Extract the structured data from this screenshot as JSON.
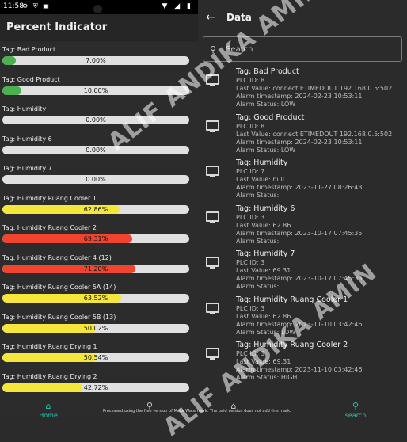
{
  "status": {
    "time": "11:58",
    "left_icons": "⚙ ⛨ ▣",
    "right_icons": "▼ ◢ ▮"
  },
  "left": {
    "title": "Percent Indicator",
    "items": [
      {
        "tag": "Tag: Bad Product",
        "percent_text": "7.00%",
        "value": 7.0,
        "color": "#4caf50"
      },
      {
        "tag": "Tag: Good Product",
        "percent_text": "10.00%",
        "value": 10.0,
        "color": "#4caf50"
      },
      {
        "tag": "Tag: Humidity",
        "percent_text": "0.00%",
        "value": 0.0,
        "color": "#4caf50"
      },
      {
        "tag": "Tag: Humidity 6",
        "percent_text": "0.00%",
        "value": 0.0,
        "color": "#4caf50"
      },
      {
        "tag": "Tag: Humidity 7",
        "percent_text": "0.00%",
        "value": 0.0,
        "color": "#4caf50"
      },
      {
        "tag": "Tag: Humidity Ruang Cooler 1",
        "percent_text": "62.86%",
        "value": 62.86,
        "color": "#f5e63b"
      },
      {
        "tag": "Tag: Humidity Ruang Cooler 2",
        "percent_text": "69.31%",
        "value": 69.31,
        "color": "#f0442e"
      },
      {
        "tag": "Tag: Humidity Ruang Cooler 4 (12)",
        "percent_text": "71.20%",
        "value": 71.2,
        "color": "#f0442e"
      },
      {
        "tag": "Tag: Humidity Ruang Cooler 5A (14)",
        "percent_text": "63.52%",
        "value": 63.52,
        "color": "#f5e63b"
      },
      {
        "tag": "Tag: Humidity Ruang Cooler 5B (13)",
        "percent_text": "50.02%",
        "value": 50.02,
        "color": "#f5e63b"
      },
      {
        "tag": "Tag: Humidity Ruang Drying 1",
        "percent_text": "50.54%",
        "value": 50.54,
        "color": "#f5e63b"
      },
      {
        "tag": "Tag: Humidity Ruang Drying 2",
        "percent_text": "42.72%",
        "value": 42.72,
        "color": "#f5e63b"
      }
    ],
    "nav": {
      "home_label": "Home",
      "home_icon": "home-icon",
      "search_icon": "search-icon"
    }
  },
  "right": {
    "title": "Data",
    "search_placeholder": "Search",
    "items": [
      {
        "tag": "Tag: Bad Product",
        "plc": "PLC ID: 8",
        "last": "Last Value: connect ETIMEDOUT 192.168.0.5:502",
        "ts": "Alarm timestamp: 2024-02-23 10:53:11",
        "status": "Alarm Status: LOW"
      },
      {
        "tag": "Tag: Good Product",
        "plc": "PLC ID: 8",
        "last": "Last Value: connect ETIMEDOUT 192.168.0.5:502",
        "ts": "Alarm timestamp: 2024-02-23 10:53:11",
        "status": "Alarm Status: LOW"
      },
      {
        "tag": "Tag: Humidity",
        "plc": "PLC ID: 7",
        "last": "Last Value: null",
        "ts": "Alarm timestamp: 2023-11-27 08:26:43",
        "status": "Alarm Status:"
      },
      {
        "tag": "Tag: Humidity 6",
        "plc": "PLC ID: 3",
        "last": "Last Value: 62.86",
        "ts": "Alarm timestamp: 2023-10-17 07:45:35",
        "status": "Alarm Status:"
      },
      {
        "tag": "Tag: Humidity 7",
        "plc": "PLC ID: 3",
        "last": "Last Value: 69.31",
        "ts": "Alarm timestamp: 2023-10-17 07:45:35",
        "status": "Alarm Status:"
      },
      {
        "tag": "Tag: Humidity Ruang Cooler 1",
        "plc": "PLC ID: 3",
        "last": "Last Value: 62.86",
        "ts": "Alarm timestamp: 2023-11-10 03:42:46",
        "status": "Alarm Status: LOW"
      },
      {
        "tag": "Tag: Humidity Ruang Cooler 2",
        "plc": "PLC ID: 3",
        "last": "Last Value: 69.31",
        "ts": "Alarm timestamp: 2023-11-10 03:42:46",
        "status": "Alarm Status: HIGH"
      }
    ],
    "nav": {
      "search_label": "search",
      "search_icon": "search-icon",
      "home_icon": "home-icon"
    }
  },
  "footer_note": "Processed using the free version of Make Watermark. The paid version does not add this mark.",
  "watermark": "ALIF ANDIKA AMIN"
}
